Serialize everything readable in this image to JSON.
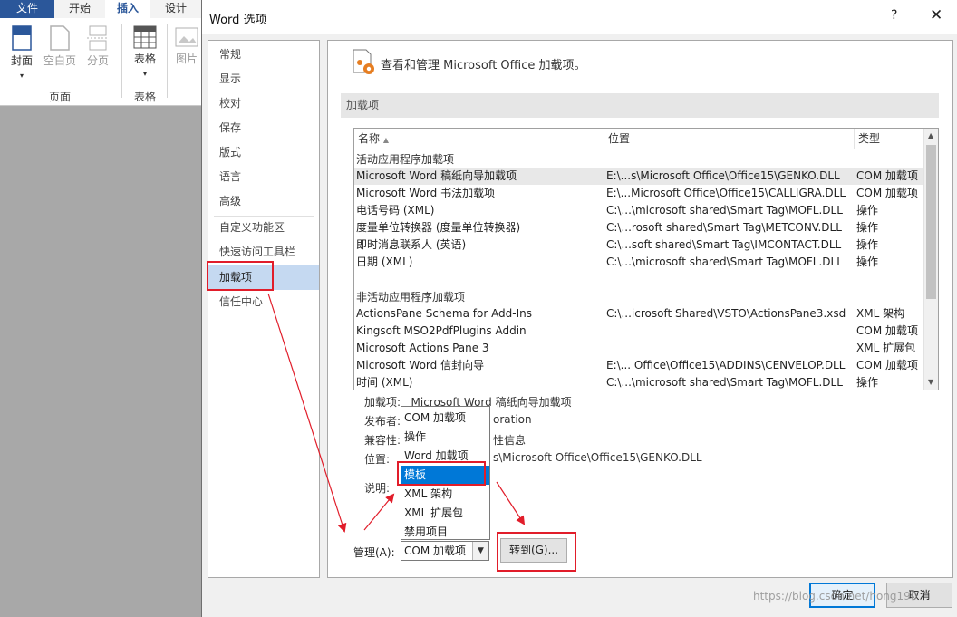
{
  "ribbon": {
    "tabs": [
      "文件",
      "开始",
      "插入",
      "设计"
    ],
    "buttons": {
      "cover": "封面",
      "blank_page": "空白页",
      "page_break": "分页",
      "table": "表格",
      "picture": "图片"
    },
    "groups": {
      "pages": "页面",
      "tables": "表格"
    }
  },
  "dialog": {
    "title": "Word 选项",
    "help": "?",
    "close": "✕",
    "nav": [
      "常规",
      "显示",
      "校对",
      "保存",
      "版式",
      "语言",
      "高级",
      "自定义功能区",
      "快速访问工具栏",
      "加载项",
      "信任中心"
    ],
    "nav_selected": "加载项",
    "header": "查看和管理 Microsoft Office 加载项。",
    "section": "加载项",
    "columns": {
      "name": "名称",
      "location": "位置",
      "type": "类型"
    },
    "active_group": "活动应用程序加载项",
    "active_rows": [
      {
        "name": "Microsoft Word 稿纸向导加载项",
        "location": "E:\\...s\\Microsoft Office\\Office15\\GENKO.DLL",
        "type": "COM 加载项"
      },
      {
        "name": "Microsoft Word 书法加载项",
        "location": "E:\\...Microsoft Office\\Office15\\CALLIGRA.DLL",
        "type": "COM 加载项"
      },
      {
        "name": "电话号码 (XML)",
        "location": "C:\\...\\microsoft shared\\Smart Tag\\MOFL.DLL",
        "type": "操作"
      },
      {
        "name": "度量单位转换器 (度量单位转换器)",
        "location": "C:\\...rosoft shared\\Smart Tag\\METCONV.DLL",
        "type": "操作"
      },
      {
        "name": "即时消息联系人 (英语)",
        "location": "C:\\...soft shared\\Smart Tag\\IMCONTACT.DLL",
        "type": "操作"
      },
      {
        "name": "日期 (XML)",
        "location": "C:\\...\\microsoft shared\\Smart Tag\\MOFL.DLL",
        "type": "操作"
      }
    ],
    "inactive_group": "非活动应用程序加载项",
    "inactive_rows": [
      {
        "name": "ActionsPane Schema for Add-Ins",
        "location": "C:\\...icrosoft Shared\\VSTO\\ActionsPane3.xsd",
        "type": "XML 架构"
      },
      {
        "name": "Kingsoft MSO2PdfPlugins Addin",
        "location": "",
        "type": "COM 加载项"
      },
      {
        "name": "Microsoft Actions Pane 3",
        "location": "",
        "type": "XML 扩展包"
      },
      {
        "name": "Microsoft Word 信封向导",
        "location": "E:\\... Office\\Office15\\ADDINS\\CENVELOP.DLL",
        "type": "COM 加载项"
      },
      {
        "name": "时间 (XML)",
        "location": "C:\\...\\microsoft shared\\Smart Tag\\MOFL.DLL",
        "type": "操作"
      }
    ],
    "details": {
      "addin_label": "加载项:",
      "addin_value": "Microsoft Word 稿纸向导加载项",
      "publisher_label": "发布者:",
      "publisher_value": "oration",
      "compat_label": "兼容性:",
      "compat_value": "性信息",
      "location_label": "位置:",
      "location_value": "s\\Microsoft Office\\Office15\\GENKO.DLL",
      "desc_label": "说明:"
    },
    "manage_label": "管理(A):",
    "manage_value": "COM 加载项",
    "manage_options": [
      "COM 加载项",
      "操作",
      "Word 加载项",
      "模板",
      "XML 架构",
      "XML 扩展包",
      "禁用项目"
    ],
    "manage_highlighted": "模板",
    "goto_button": "转到(G)...",
    "ok_button": "确定",
    "cancel_button": "取消",
    "watermark": "https://blog.csdn.net/hong190"
  },
  "colors": {
    "annotation": "#e11d2a",
    "selection": "#0078d7",
    "nav_selected": "#c5d9f1",
    "ribbon": "#2b579a"
  }
}
